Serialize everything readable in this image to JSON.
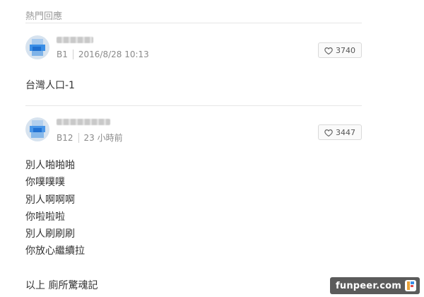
{
  "header": {
    "title": "熱門回應"
  },
  "comments": [
    {
      "floor": "B1",
      "time": "2016/8/28 10:13",
      "likes": "3740",
      "lines": [
        "台灣人口-1"
      ]
    },
    {
      "floor": "B12",
      "time": "23 小時前",
      "likes": "3447",
      "lines": [
        "別人啪啪啪",
        "你噗噗噗",
        "別人啊啊啊",
        "你啦啦啦",
        "別人刷刷刷",
        "你放心繼續拉",
        "以上 廁所驚魂記"
      ]
    }
  ],
  "watermark": {
    "text": "funpeer.com"
  },
  "colors": {
    "avatar_blue": "#3a8ee6",
    "accent": "#e8a23a"
  }
}
